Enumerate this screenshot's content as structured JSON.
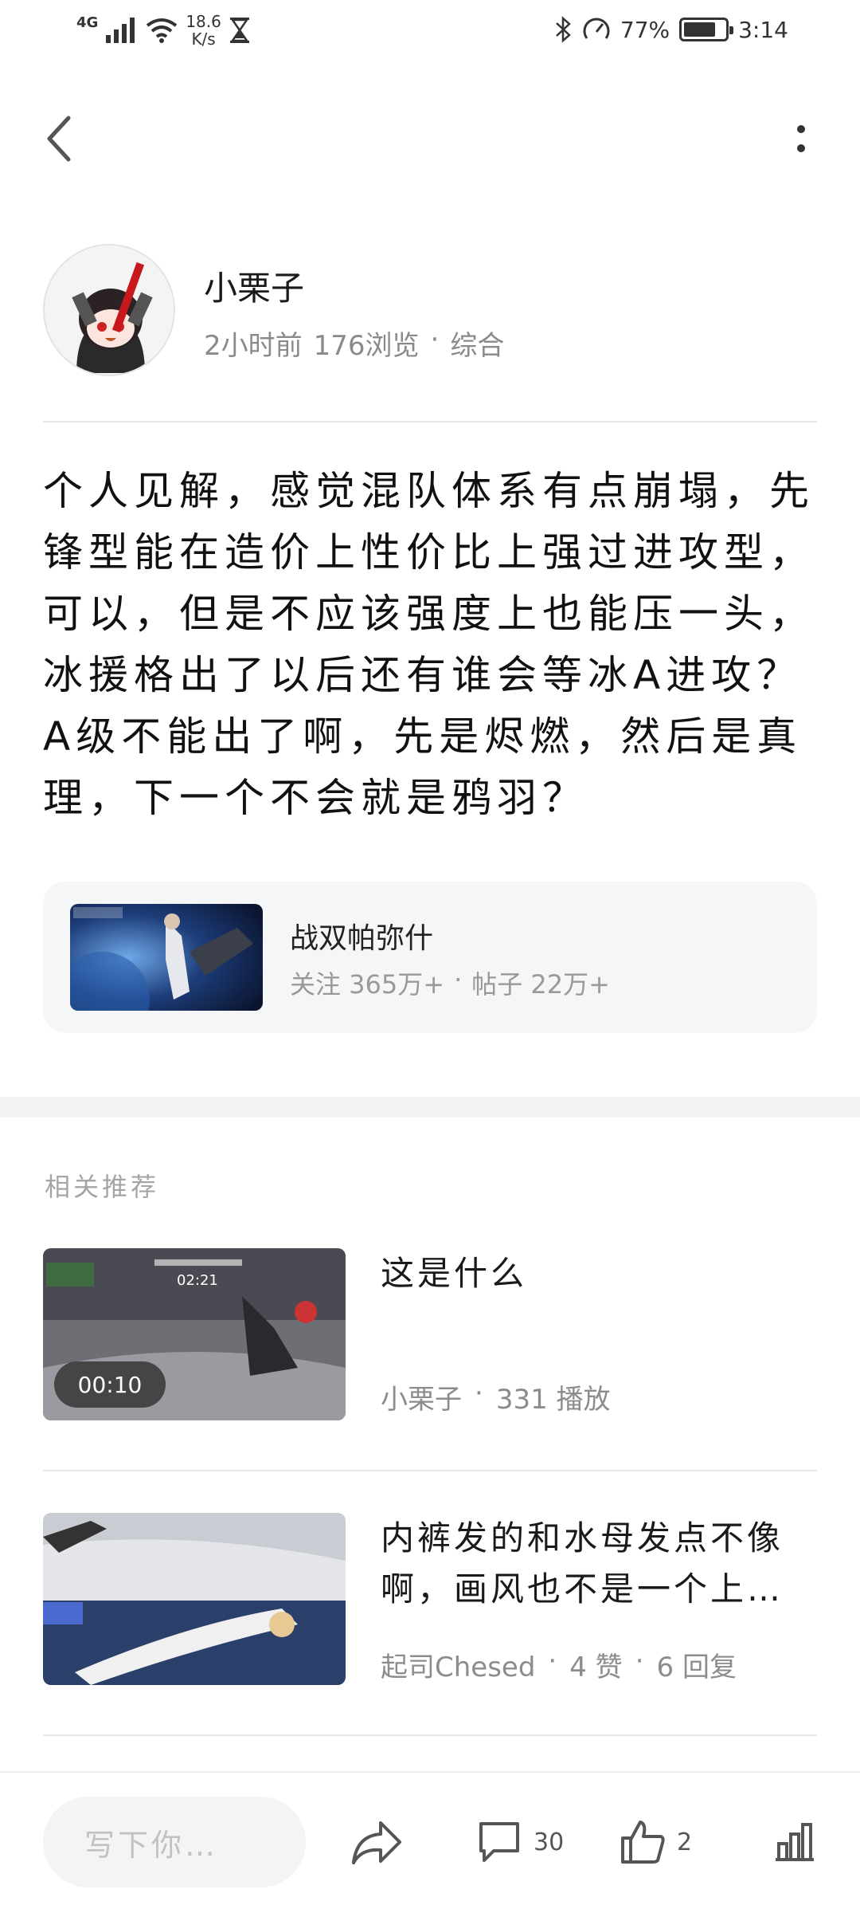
{
  "status_bar": {
    "network": "4G",
    "speed_value": "18.6",
    "speed_unit": "K/s",
    "battery_percent": "77%",
    "battery_level": 0.77,
    "time": "3:14"
  },
  "nav": {
    "back_icon": "chevron-left-icon",
    "more_icon": "more-vertical-icon"
  },
  "author": {
    "name": "小栗子",
    "time_ago": "2小时前",
    "views": "176浏览",
    "separator": "·",
    "category": "综合"
  },
  "post": {
    "body": "个人见解，感觉混队体系有点崩塌，先锋型能在造价上性价比上强过进攻型，可以，但是不应该强度上也能压一头，冰援格出了以后还有谁会等冰A进攻？A级不能出了啊，先是烬燃，然后是真理，下一个不会就是鸦羽？"
  },
  "community": {
    "name": "战双帕弥什",
    "followers": "关注 365万+",
    "separator": "·",
    "posts": "帖子 22万+"
  },
  "recommend": {
    "section_title": "相关推荐",
    "items": [
      {
        "title": "这是什么",
        "author": "小栗子",
        "separator": "·",
        "stat": "331 播放",
        "duration": "00:10"
      },
      {
        "title": "内裤发的和水母发点不像啊，画风也不是一个上…",
        "author": "起司Chesed",
        "separator1": "·",
        "likes": "4 赞",
        "separator2": "·",
        "replies": "6 回复"
      }
    ]
  },
  "bottom_bar": {
    "comment_placeholder": "写下你…",
    "comment_count": "30",
    "like_count": "2"
  },
  "colors": {
    "text_primary": "#1a1a1a",
    "text_secondary": "#8a8a8a",
    "card_bg": "#f5f6f8",
    "divider": "#e5e5e5"
  }
}
